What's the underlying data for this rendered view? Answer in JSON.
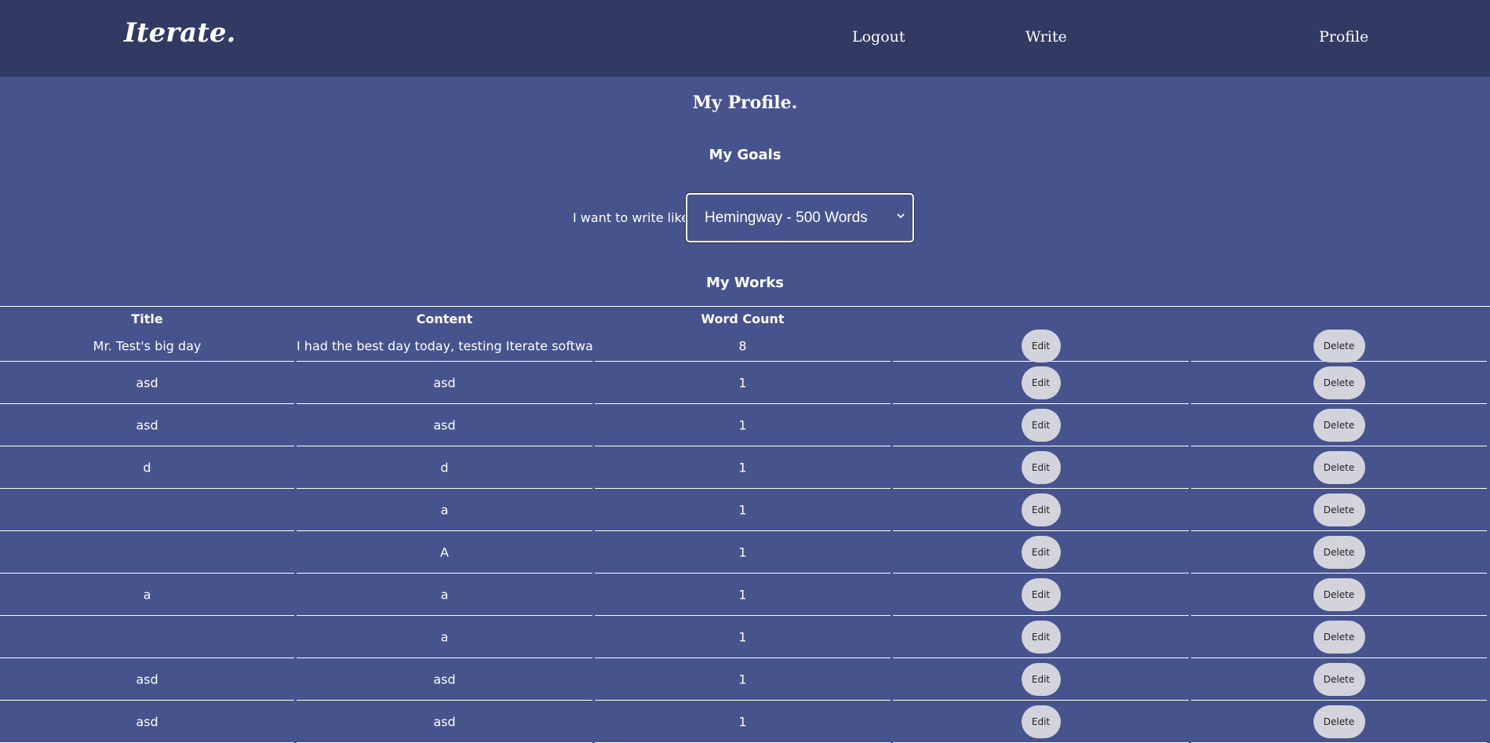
{
  "nav": {
    "brand": "Iterate.",
    "logout": "Logout",
    "write": "Write",
    "profile": "Profile"
  },
  "page": {
    "title": "My Profile.",
    "goals_title": "My Goals",
    "works_title": "My Works"
  },
  "goal": {
    "label": "I want to write like...",
    "selected": "Hemingway - 500 Words"
  },
  "table": {
    "headers": [
      "Title",
      "Content",
      "Word Count"
    ],
    "edit_label": "Edit",
    "delete_label": "Delete",
    "rows": [
      {
        "title": "Mr. Test's big day",
        "content": "I had the best day today, testing Iterate software...",
        "count": "8"
      },
      {
        "title": "asd",
        "content": "asd",
        "count": "1"
      },
      {
        "title": "asd",
        "content": "asd",
        "count": "1"
      },
      {
        "title": "d",
        "content": "d",
        "count": "1"
      },
      {
        "title": "",
        "content": "a",
        "count": "1"
      },
      {
        "title": "",
        "content": "A",
        "count": "1"
      },
      {
        "title": "a",
        "content": "a",
        "count": "1"
      },
      {
        "title": "",
        "content": "a",
        "count": "1"
      },
      {
        "title": "asd",
        "content": "asd",
        "count": "1"
      },
      {
        "title": "asd",
        "content": "asd",
        "count": "1"
      }
    ]
  },
  "colors": {
    "navbar": "#313a63",
    "background": "#47538c",
    "button": "#d3d3dc"
  }
}
